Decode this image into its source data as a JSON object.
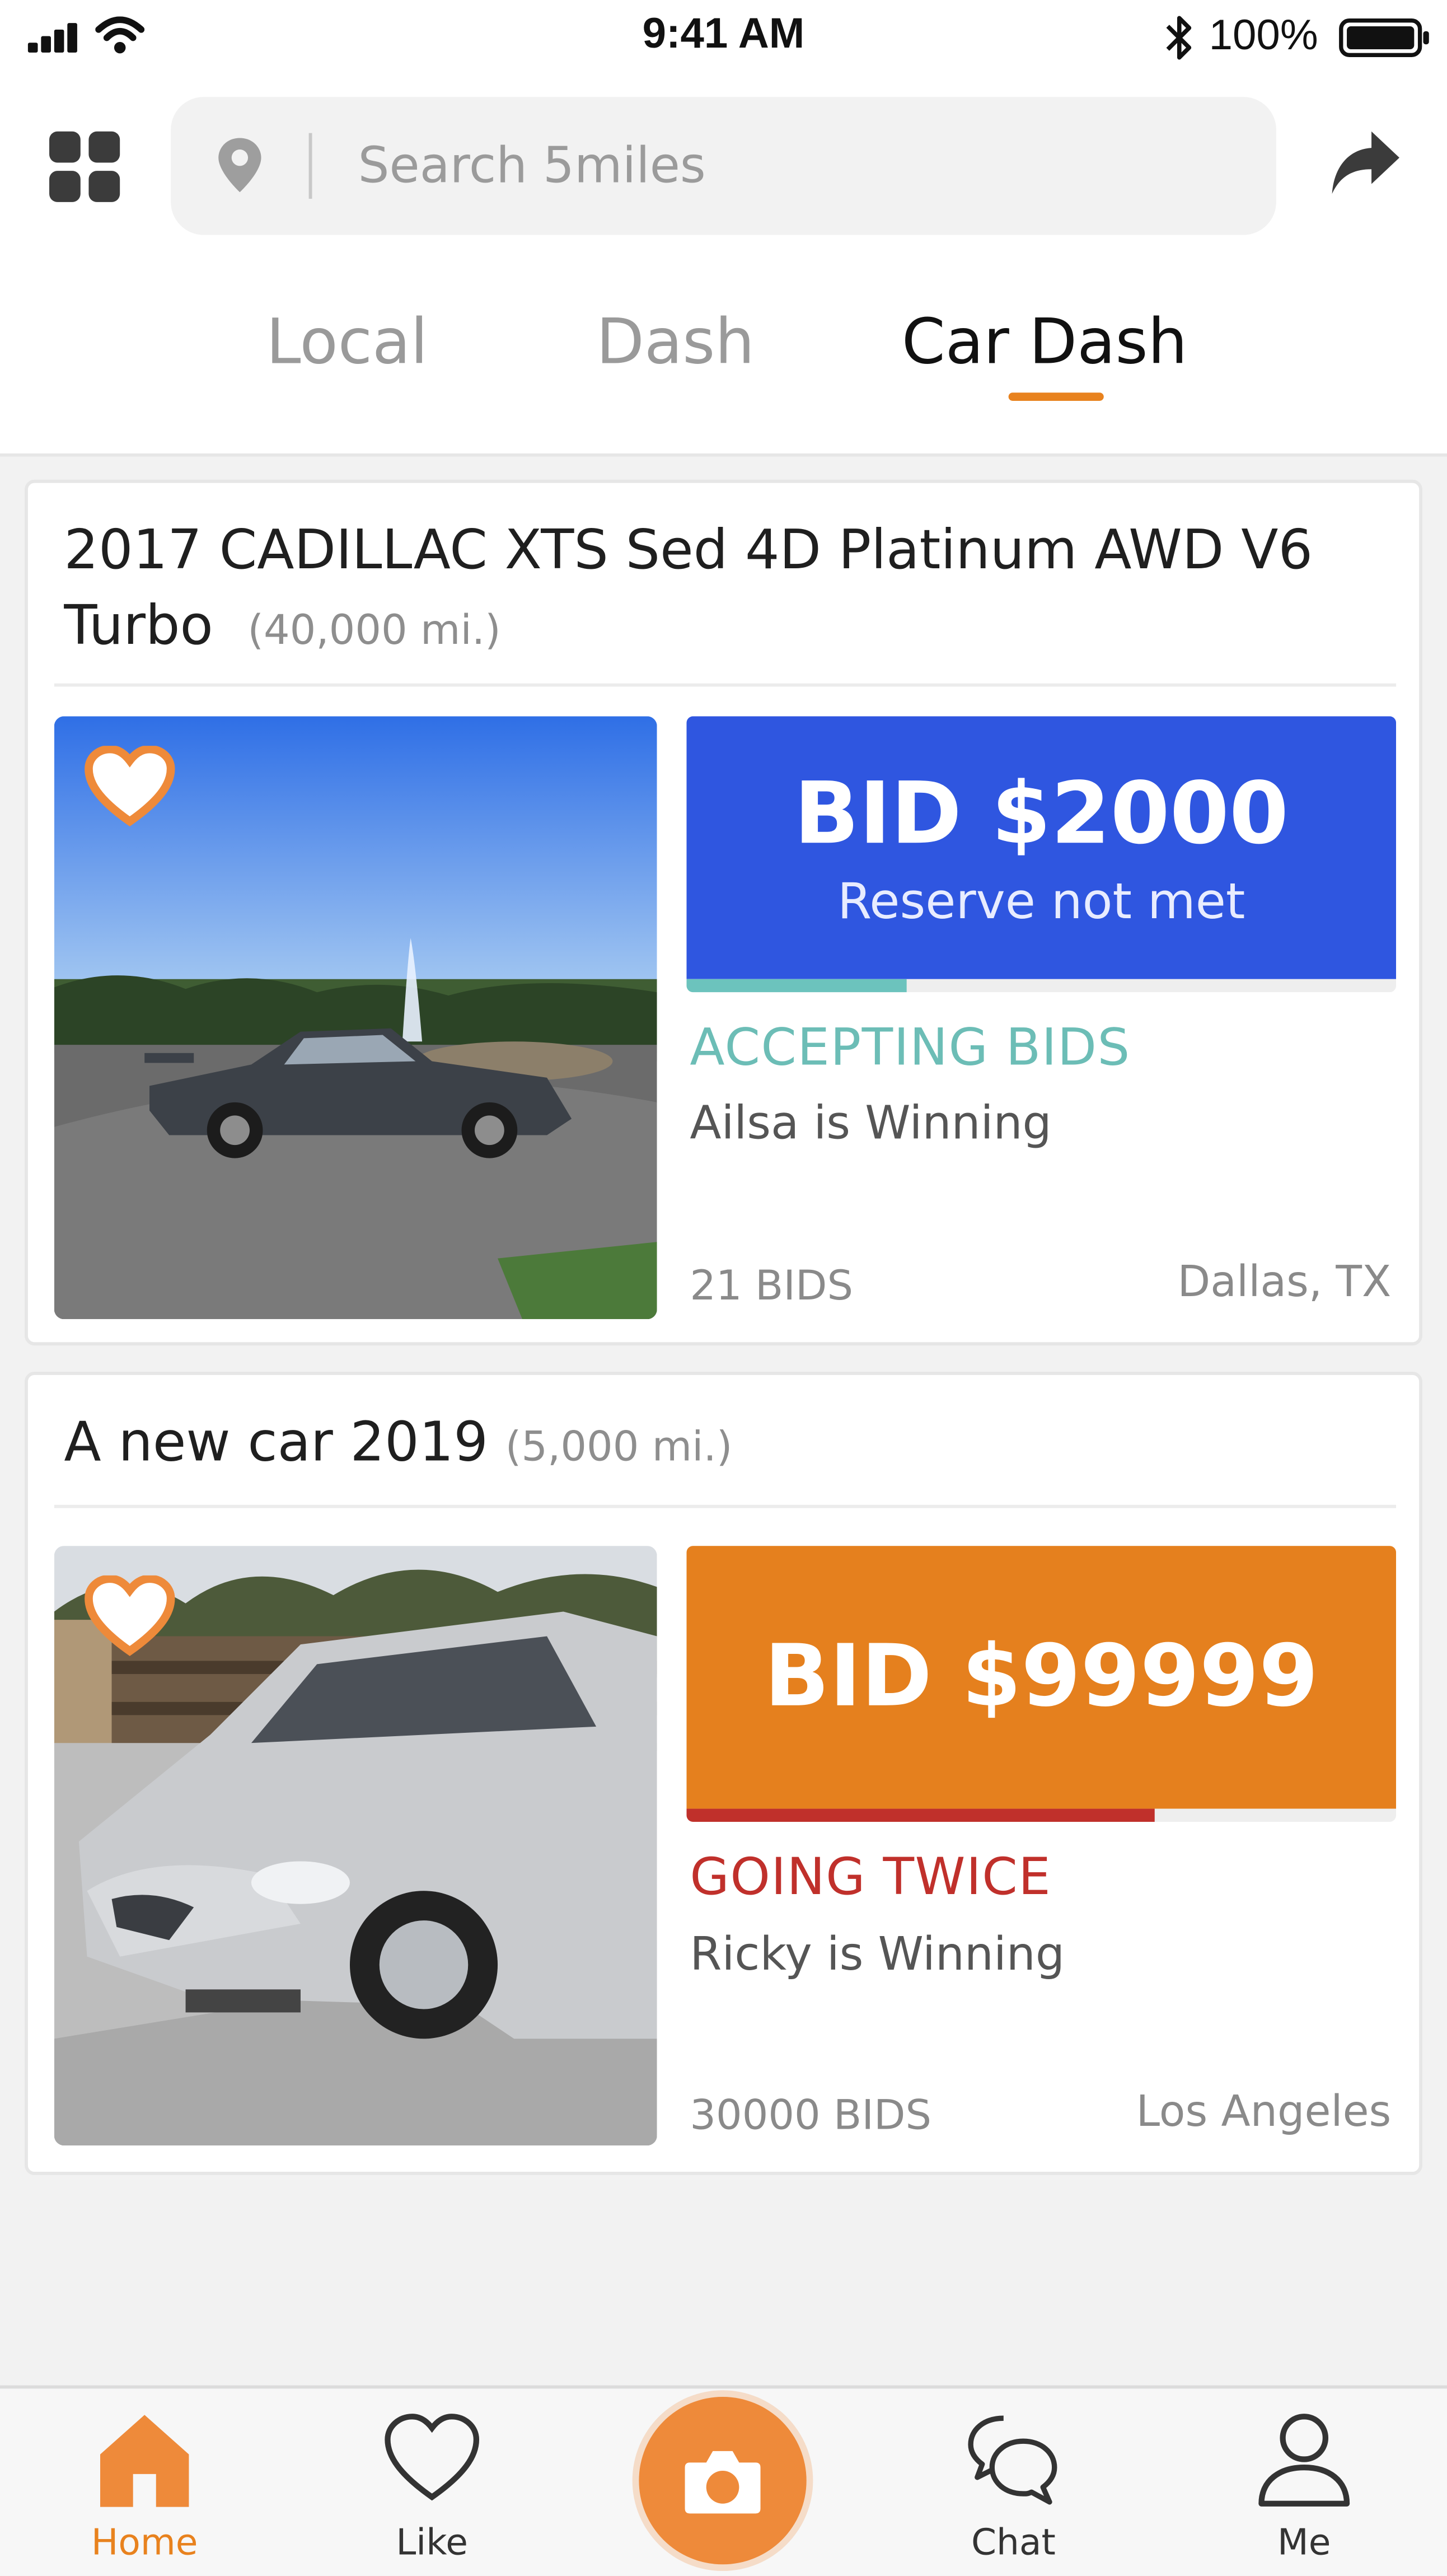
{
  "status_bar": {
    "time": "9:41 AM",
    "battery": "100%",
    "icons": [
      "signal-icon",
      "wifi-icon",
      "bluetooth-icon",
      "battery-icon"
    ]
  },
  "header": {
    "search": {
      "placeholder": "Search 5miles",
      "value": ""
    },
    "icons": [
      "grid-icon",
      "location-pin-icon",
      "share-icon"
    ],
    "tabs": [
      {
        "label": "Local",
        "active": false
      },
      {
        "label": "Dash",
        "active": false
      },
      {
        "label": "Car Dash",
        "active": true
      }
    ]
  },
  "listings": [
    {
      "title": "2017 CADILLAC XTS Sed 4D Platinum AWD V6 Turbo",
      "mileage": "(40,000 mi.)",
      "bid": "BID $2000",
      "reserve": "Reserve not met",
      "status": "ACCEPTING BIDS",
      "winner": "Ailsa is Winning",
      "bids": "21 BIDS",
      "location": "Dallas, TX",
      "progress": 0.31,
      "bid_color": "#2f56e0",
      "progress_color": "#6cc3bd",
      "status_color": "#6cbdb6"
    },
    {
      "title": "A new car 2019",
      "mileage": "(5,000 mi.)",
      "bid": "BID $99999",
      "status": "GOING TWICE",
      "winner": "Ricky is Winning",
      "bids": "30000 BIDS",
      "location": "Los Angeles",
      "progress": 0.66,
      "bid_color": "#e5801e",
      "progress_color": "#c0302b",
      "status_color": "#c0302b"
    }
  ],
  "tab_bar": {
    "items": [
      {
        "label": "Home",
        "icon": "home-icon",
        "active": true
      },
      {
        "label": "Like",
        "icon": "heart-icon",
        "active": false
      },
      {
        "label": "",
        "icon": "camera-icon",
        "active": false
      },
      {
        "label": "Chat",
        "icon": "chat-icon",
        "active": false
      },
      {
        "label": "Me",
        "icon": "person-icon",
        "active": false
      }
    ]
  },
  "colors": {
    "accent": "#e8821e",
    "background": "#f2f2f2"
  }
}
